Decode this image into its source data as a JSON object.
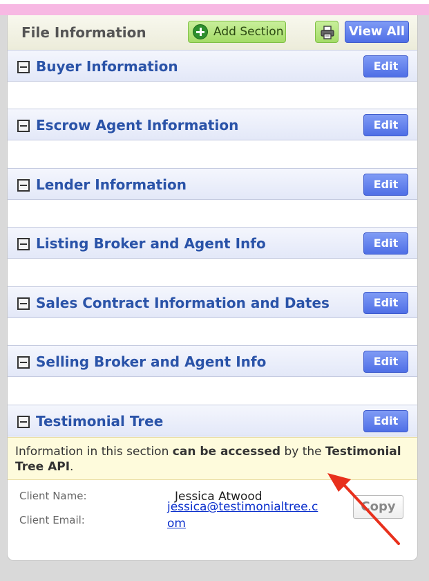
{
  "panel": {
    "title": "File Information",
    "add_section_label": "Add Section",
    "view_all_label": "View All"
  },
  "sections": [
    {
      "title": "Buyer Information",
      "edit_label": "Edit"
    },
    {
      "title": "Escrow Agent Information",
      "edit_label": "Edit"
    },
    {
      "title": "Lender Information",
      "edit_label": "Edit"
    },
    {
      "title": "Listing Broker and Agent Info",
      "edit_label": "Edit"
    },
    {
      "title": "Sales Contract Information and Dates",
      "edit_label": "Edit"
    },
    {
      "title": "Selling Broker and Agent Info",
      "edit_label": "Edit"
    },
    {
      "title": "Testimonial Tree",
      "edit_label": "Edit"
    }
  ],
  "notice": {
    "part1": "Information in this section ",
    "bold1": "can be accessed",
    "part2": " by the ",
    "bold2": "Testimonial Tree API",
    "part3": "."
  },
  "client": {
    "name_label": "Client Name:",
    "name_value": "Jessica Atwood",
    "email_label": "Client Email:",
    "email_value": "jessica@testimonialtree.com",
    "copy_label": "Copy"
  },
  "colors": {
    "section_title": "#2a53a8",
    "arrow": "#e8301c",
    "notice_bg": "#fefbdc"
  }
}
